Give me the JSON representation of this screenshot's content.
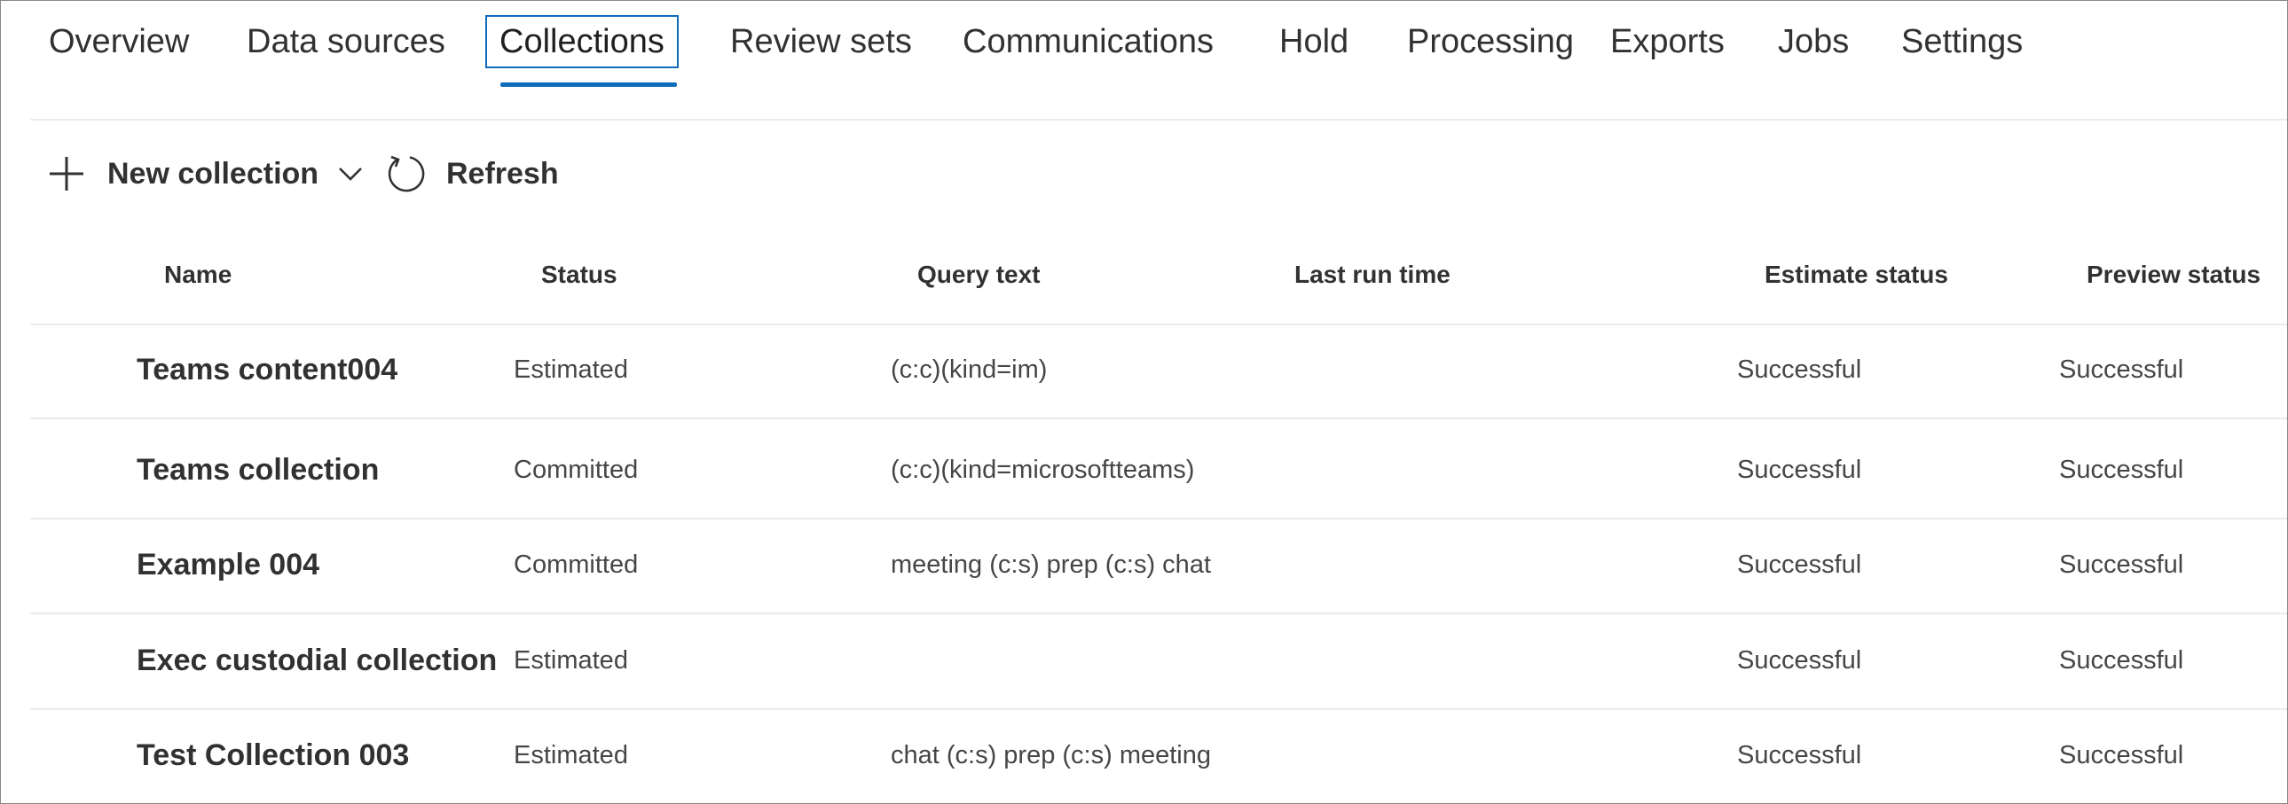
{
  "tabs": [
    {
      "label": "Overview"
    },
    {
      "label": "Data sources"
    },
    {
      "label": "Collections"
    },
    {
      "label": "Review sets"
    },
    {
      "label": "Communications"
    },
    {
      "label": "Hold"
    },
    {
      "label": "Processing"
    },
    {
      "label": "Exports"
    },
    {
      "label": "Jobs"
    },
    {
      "label": "Settings"
    }
  ],
  "active_tab": "Collections",
  "toolbar": {
    "new_collection_label": "New collection",
    "refresh_label": "Refresh"
  },
  "table": {
    "columns": [
      "Name",
      "Status",
      "Query text",
      "Last run time",
      "Estimate status",
      "Preview status"
    ],
    "rows": [
      {
        "name": "Teams content004",
        "status": "Estimated",
        "query": "(c:c)(kind=im)",
        "last_run": "",
        "estimate_status": "Successful",
        "preview_status": "Successful"
      },
      {
        "name": "Teams collection",
        "status": "Committed",
        "query": "(c:c)(kind=microsoftteams)",
        "last_run": "",
        "estimate_status": "Successful",
        "preview_status": "Successful"
      },
      {
        "name": "Example 004",
        "status": "Committed",
        "query": "meeting (c:s) prep (c:s) chat",
        "last_run": "",
        "estimate_status": "Successful",
        "preview_status": "Successful"
      },
      {
        "name": "Exec custodial collection",
        "status": "Estimated",
        "query": "",
        "last_run": "",
        "estimate_status": "Successful",
        "preview_status": "Successful"
      },
      {
        "name": "Test Collection 003",
        "status": "Estimated",
        "query": "chat (c:s) prep (c:s) meeting",
        "last_run": "",
        "estimate_status": "Successful",
        "preview_status": "Successful"
      }
    ]
  },
  "icons": {
    "new": "plus-icon",
    "dropdown": "chevron-down-icon",
    "refresh": "refresh-icon"
  },
  "colors": {
    "accent": "#0f6cbd",
    "text": "#323130",
    "divider": "#edebe9"
  }
}
